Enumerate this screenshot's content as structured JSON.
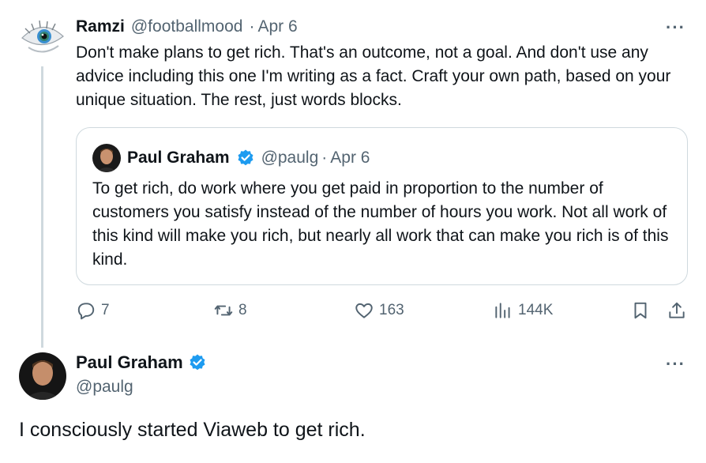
{
  "reply_tweet": {
    "author_name": "Ramzi",
    "handle": "@footballmood",
    "separator": "·",
    "date": "Apr 6",
    "more_label": "···",
    "text": "Don't make plans to get rich. That's an outcome, not a goal. And don't use any advice including this one I'm writing as a fact. Craft your own path, based on your unique situation. The rest, just words blocks."
  },
  "quoted_tweet": {
    "author_name": "Paul Graham",
    "handle": "@paulg",
    "separator": "·",
    "date": "Apr 6",
    "text": "To get rich, do work where you get paid in proportion to the number of customers you satisfy instead of the number of hours you work. Not all work of this kind will make you rich, but nearly all work that can make you rich is of this kind."
  },
  "actions": {
    "replies": "7",
    "retweets": "8",
    "likes": "163",
    "views": "144K"
  },
  "main_tweet": {
    "author_name": "Paul Graham",
    "handle": "@paulg",
    "more_label": "···",
    "text": "I consciously started Viaweb to get rich."
  },
  "colors": {
    "verified": "#1d9bf0",
    "muted": "#536471",
    "border": "#cfd9de"
  }
}
